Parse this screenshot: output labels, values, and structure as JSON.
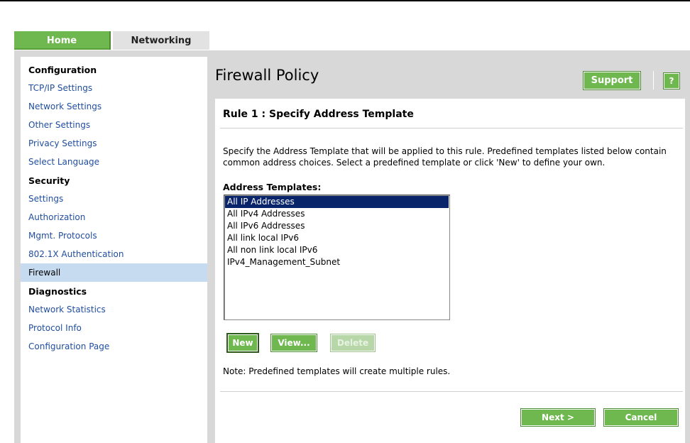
{
  "tabs": [
    {
      "label": "Home"
    },
    {
      "label": "Networking"
    }
  ],
  "sidebar": {
    "items": [
      {
        "label": "Configuration",
        "type": "heading"
      },
      {
        "label": "TCP/IP Settings"
      },
      {
        "label": "Network Settings"
      },
      {
        "label": "Other Settings"
      },
      {
        "label": "Privacy Settings"
      },
      {
        "label": "Select Language"
      },
      {
        "label": "Security",
        "type": "heading"
      },
      {
        "label": "Settings"
      },
      {
        "label": "Authorization"
      },
      {
        "label": "Mgmt. Protocols"
      },
      {
        "label": "802.1X Authentication"
      },
      {
        "label": "Firewall",
        "active": true
      },
      {
        "label": "Diagnostics",
        "type": "heading"
      },
      {
        "label": "Network Statistics"
      },
      {
        "label": "Protocol Info"
      },
      {
        "label": "Configuration Page"
      }
    ]
  },
  "header": {
    "title": "Firewall Policy",
    "support_label": "Support",
    "help_label": "?"
  },
  "main": {
    "rule_title": "Rule 1 : Specify Address Template",
    "description": "Specify the Address Template that will be applied to this rule. Predefined templates listed below contain common address choices. Select a predefined template or click 'New' to define your own.",
    "templates_label": "Address Templates:",
    "templates": [
      "All IP Addresses",
      "All IPv4 Addresses",
      "All IPv6 Addresses",
      "All link local IPv6",
      "All non link local IPv6",
      "IPv4_Management_Subnet"
    ],
    "selected_template": "All IP Addresses",
    "new_label": "New",
    "view_label": "View...",
    "delete_label": "Delete",
    "note": "Note: Predefined templates will create multiple rules.",
    "next_label": "Next >",
    "cancel_label": "Cancel"
  },
  "colors": {
    "accent_green": "#6fb84f",
    "selection_blue": "#0a246a",
    "active_sidebar": "#c6daf0",
    "link_blue": "#1f4d9e"
  }
}
